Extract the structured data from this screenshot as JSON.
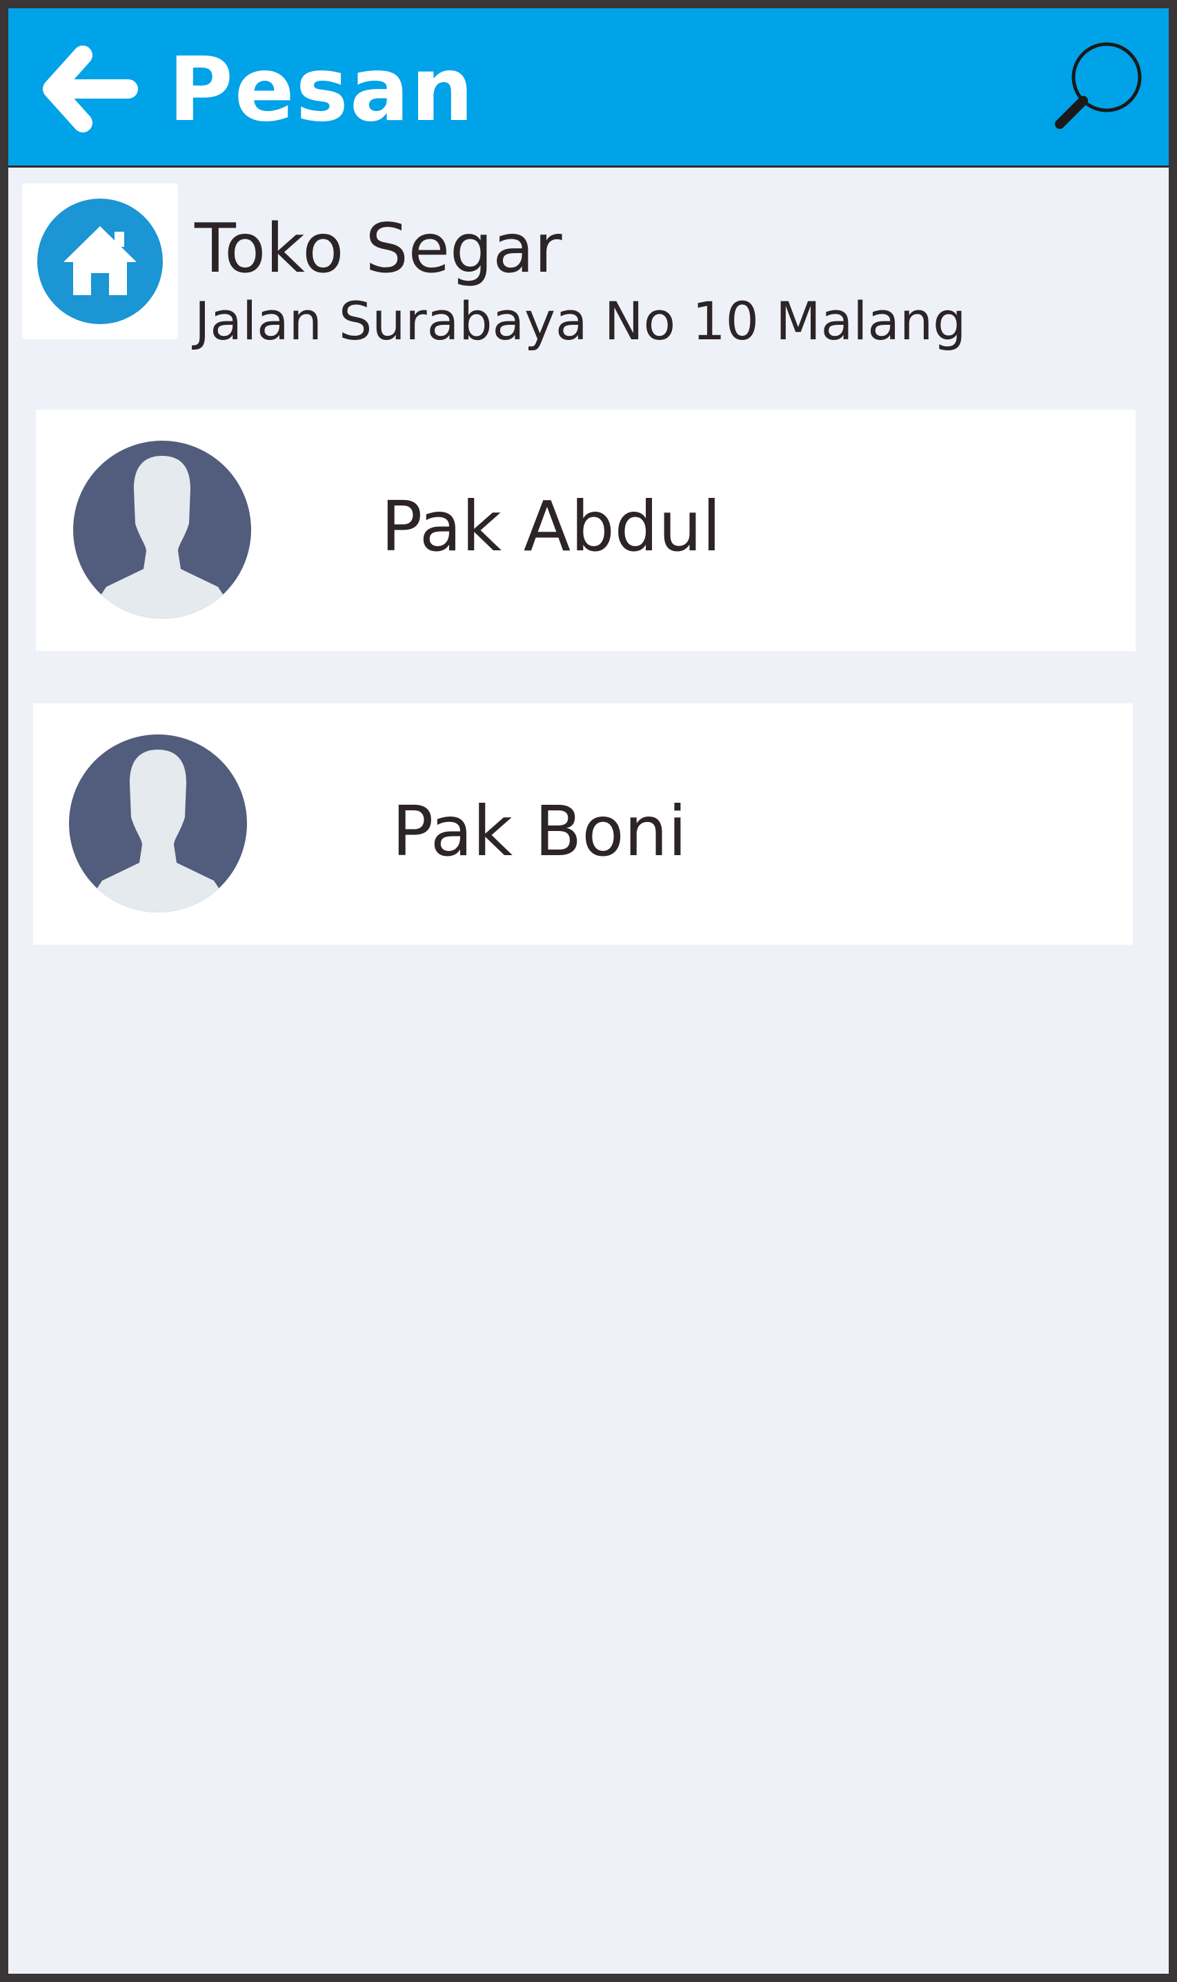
{
  "header": {
    "title": "Pesan",
    "back_icon": "arrow-left-icon",
    "search_icon": "search-icon",
    "background_color": "#00a2e8"
  },
  "store": {
    "icon": "home-icon",
    "name": "Toko Segar",
    "address": "Jalan Surabaya No 10  Malang"
  },
  "contacts": [
    {
      "name": "Pak Abdul",
      "avatar_icon": "user-avatar-icon"
    },
    {
      "name": "Pak Boni",
      "avatar_icon": "user-avatar-icon"
    }
  ],
  "colors": {
    "page_background": "#eef2f8",
    "accent": "#00a2e8",
    "avatar_circle": "#525d7d",
    "avatar_silhouette": "#e5eaee",
    "store_icon_circle": "#1b95d3",
    "text": "#2c2426"
  }
}
